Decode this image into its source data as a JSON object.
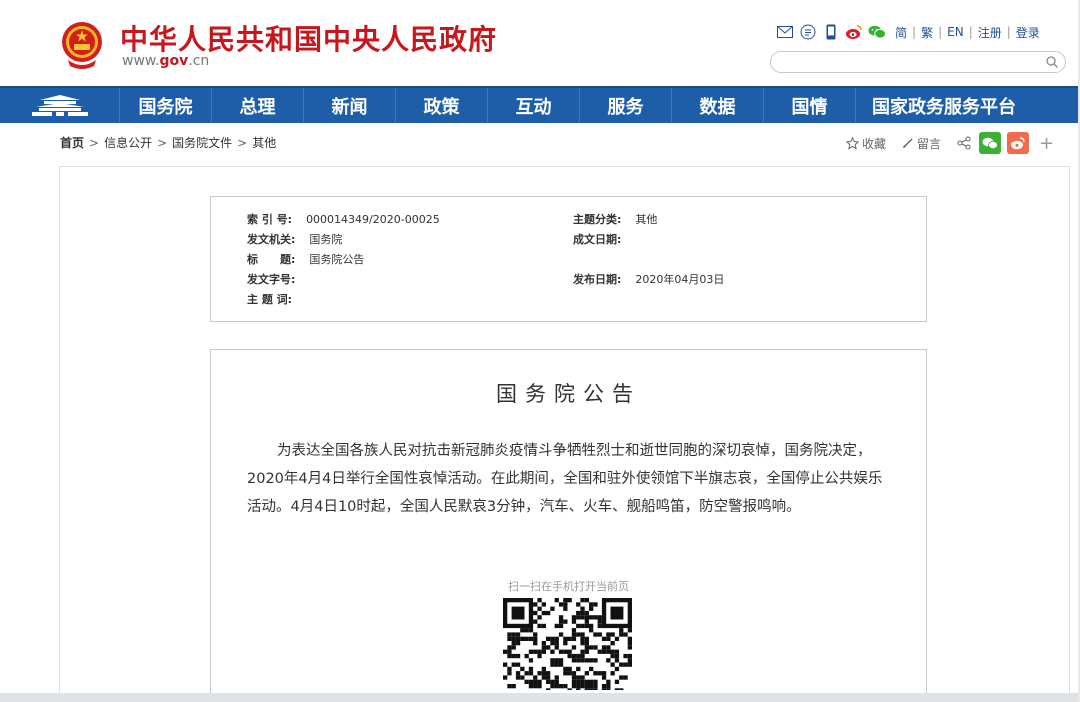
{
  "header": {
    "site_title": "中华人民共和国中央人民政府",
    "url_prefix": "www.",
    "url_domain": "gov",
    "url_suffix": ".cn",
    "links": [
      "简",
      "繁",
      "EN",
      "注册",
      "登录"
    ],
    "icons": [
      "mail-icon",
      "subscribe-icon",
      "mobile-icon",
      "weibo-icon",
      "wechat-icon"
    ],
    "search_placeholder": ""
  },
  "nav": {
    "items": [
      "国务院",
      "总理",
      "新闻",
      "政策",
      "互动",
      "服务",
      "数据",
      "国情",
      "国家政务服务平台"
    ]
  },
  "breadcrumb": {
    "items": [
      "首页",
      "信息公开",
      "国务院文件",
      "其他"
    ]
  },
  "tools": {
    "favorite": "收藏",
    "comment": "留言",
    "more": "+"
  },
  "meta": {
    "index_label": "索 引 号:",
    "index_value": "000014349/2020-00025",
    "topic_label": "主题分类:",
    "topic_value": "其他",
    "issuer_label": "发文机关:",
    "issuer_value": "国务院",
    "written_label": "成文日期:",
    "written_value": "",
    "title_label": "标　　题:",
    "title_value": "国务院公告",
    "doc_no_label": "发文字号:",
    "doc_no_value": "",
    "publish_label": "发布日期:",
    "publish_value": "2020年04月03日",
    "keywords_label": "主 题 词:",
    "keywords_value": ""
  },
  "article": {
    "title": "国务院公告",
    "body": "为表达全国各族人民对抗击新冠肺炎疫情斗争牺牲烈士和逝世同胞的深切哀悼，国务院决定，2020年4月4日举行全国性哀悼活动。在此期间，全国和驻外使领馆下半旗志哀，全国停止公共娱乐活动。4月4日10时起，全国人民默哀3分钟，汽车、火车、舰船鸣笛，防空警报鸣响。",
    "qr_caption": "扫一扫在手机打开当前页"
  },
  "colors": {
    "brand_red": "#c8161d",
    "nav_blue": "#1e5ea8",
    "link_blue": "#1f4e9b"
  }
}
